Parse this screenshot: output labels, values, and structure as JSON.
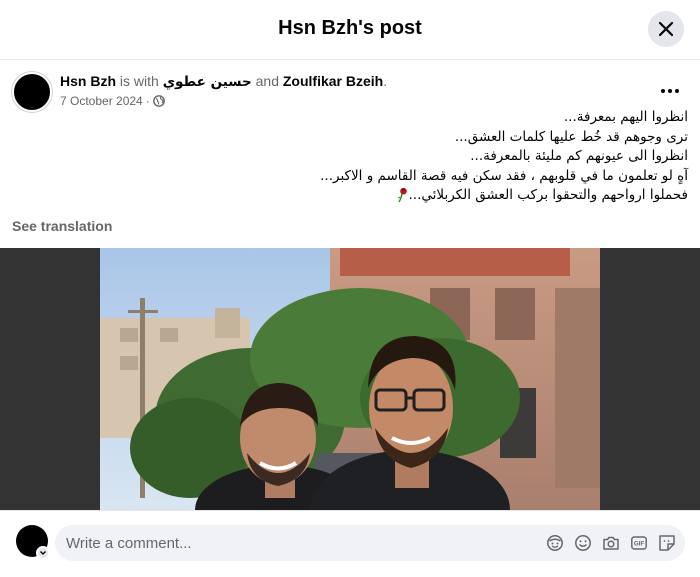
{
  "header": {
    "title": "Hsn Bzh's post",
    "close_icon": "close-icon"
  },
  "post": {
    "author": "Hsn Bzh",
    "with_text": "is with",
    "tagged_1": "حسين عطوي",
    "and_text": "and",
    "tagged_2": "Zoulfikar Bzeih",
    "tagged_2_suffix": ".",
    "date": "7 October 2024",
    "date_sep": "·",
    "audience_icon": "globe-icon",
    "more_icon": "more-dots-icon",
    "lines": [
      "انظروا اليهم بمعرفة...",
      "ترى وجوهم قد خُط عليها كلمات العشق...",
      "انظروا الى عيونهم كم مليئة بالمعرفة...",
      "آهٍ لو تعلمون ما في قلوبهم ، فقد سكن فيه قصة القاسم و الاكبر...",
      "فحملوا ارواحهم والتحقوا بركب العشق الكربلائي..."
    ],
    "emoji_icon": "wilted-rose-icon",
    "see_translation": "See translation",
    "photo_alt": "photo-of-two-young-men"
  },
  "composer": {
    "placeholder": "Write a comment...",
    "icons": [
      "avatar-sticker-icon",
      "emoji-icon",
      "camera-icon",
      "gif-icon",
      "sticker-icon"
    ]
  },
  "colors": {
    "header_bg": "#ffffff",
    "media_bg": "#333333",
    "input_bg": "#f0f2f5",
    "muted": "#65676b"
  }
}
